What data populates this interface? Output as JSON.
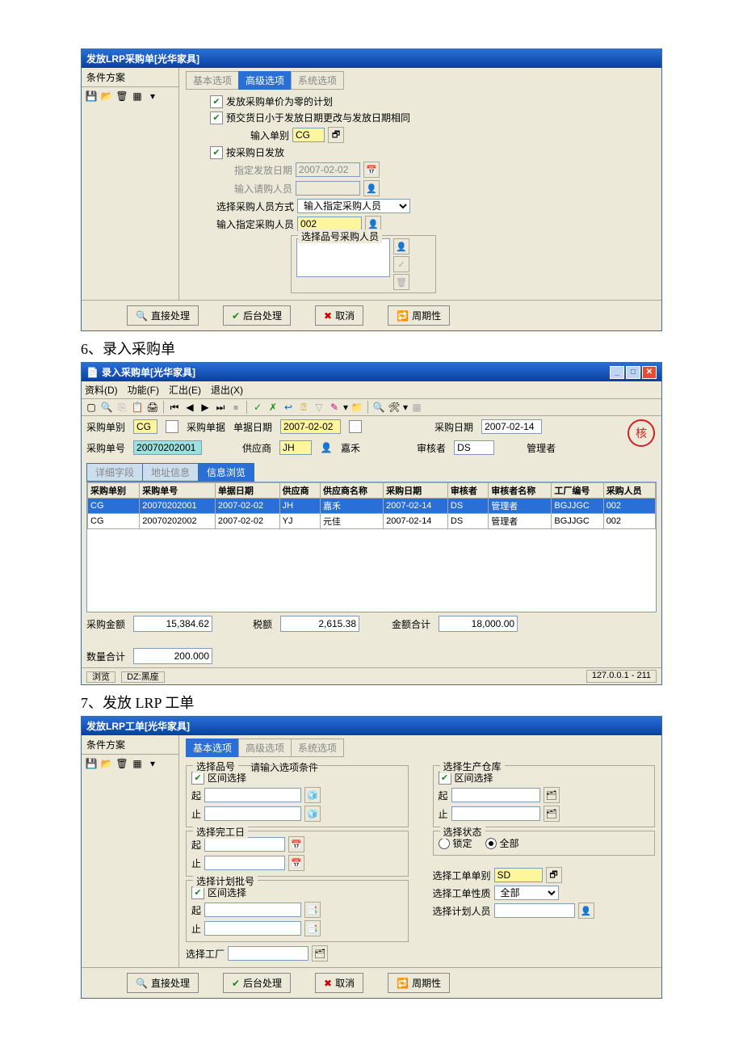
{
  "w1": {
    "title": "发放LRP采购单[光华家具]",
    "leftpanel_header": "条件方案",
    "tabs": [
      "基本选项",
      "高级选项",
      "系统选项"
    ],
    "active_tab": 1,
    "form": {
      "cb1": "发放采购单价为零的计划",
      "cb2": "预交货日小于发放日期更改与发放日期相同",
      "label_input_type": "输入单别",
      "input_type": "CG",
      "cb3": "按采购日发放",
      "label_date": "指定发放日期",
      "date": "2007-02-02",
      "label_req_person": "输入请购人员",
      "label_method": "选择采购人员方式",
      "method": "输入指定采购人员",
      "label_spec_person": "输入指定采购人员",
      "spec_person": "002",
      "group_label": "选择品号采购人员"
    },
    "buttons": {
      "direct": "直接处理",
      "background": "后台处理",
      "cancel": "取消",
      "periodic": "周期性"
    }
  },
  "heading6": "6、录入采购单",
  "w2": {
    "title": "录入采购单[光华家具]",
    "menus": [
      "资料(D)",
      "功能(F)",
      "汇出(E)",
      "退出(X)"
    ],
    "fields": {
      "l_cat": "采购单别",
      "cat": "CG",
      "cb_po": "采购单据",
      "l_docdate": "单据日期",
      "docdate": "2007-02-02",
      "l_podate": "采购日期",
      "podate": "2007-02-14",
      "l_ponum": "采购单号",
      "ponum": "20070202001",
      "l_supplier": "供应商",
      "supplier": "JH",
      "supplier_name": "嘉禾",
      "l_reviewer": "审核者",
      "reviewer": "DS",
      "reviewer_name": "管理者"
    },
    "subtabs": [
      "详细字段",
      "地址信息",
      "信息浏览"
    ],
    "active_subtab": 2,
    "grid": {
      "headers": [
        "采购单别",
        "采购单号",
        "单据日期",
        "供应商",
        "供应商名称",
        "采购日期",
        "审核者",
        "审核者名称",
        "工厂编号",
        "采购人员"
      ],
      "rows": [
        [
          "CG",
          "20070202001",
          "2007-02-02",
          "JH",
          "嘉禾",
          "2007-02-14",
          "DS",
          "管理者",
          "BGJJGC",
          "002"
        ],
        [
          "CG",
          "20070202002",
          "2007-02-02",
          "YJ",
          "元佳",
          "2007-02-14",
          "DS",
          "管理者",
          "BGJJGC",
          "002"
        ]
      ],
      "selected_row": 0
    },
    "totals": {
      "l_amount": "采购金额",
      "amount": "15,384.62",
      "l_tax": "税额",
      "tax": "2,615.38",
      "l_total": "金额合计",
      "total": "18,000.00",
      "l_qty": "数量合计",
      "qty": "200.000"
    },
    "status": {
      "left1": "浏览",
      "left2": "DZ:黑座",
      "right": "127.0.0.1 - 211"
    }
  },
  "heading7": "7、发放 LRP 工单",
  "w3": {
    "title": "发放LRP工单[光华家具]",
    "leftpanel_header": "条件方案",
    "tabs": [
      "基本选项",
      "高级选项",
      "系统选项"
    ],
    "active_tab": 0,
    "hint": "请输入选项条件",
    "left_group1": {
      "legend": "选择品号",
      "cb": "区间选择",
      "l_from": "起",
      "l_to": "止"
    },
    "left_group2": {
      "legend": "选择完工日",
      "l_from": "起",
      "l_to": "止"
    },
    "left_group3": {
      "legend": "选择计划批号",
      "cb": "区间选择",
      "l_from": "起",
      "l_to": "止"
    },
    "l_factory": "选择工厂",
    "right_group1": {
      "legend": "选择生产仓库",
      "cb": "区间选择",
      "l_from": "起",
      "l_to": "止"
    },
    "right_group2": {
      "legend": "选择状态",
      "r1": "锁定",
      "r2": "全部"
    },
    "l_ordercat": "选择工单单别",
    "ordercat": "SD",
    "l_ordernature": "选择工单性质",
    "ordernature": "全部",
    "l_planner": "选择计划人员",
    "buttons": {
      "direct": "直接处理",
      "background": "后台处理",
      "cancel": "取消",
      "periodic": "周期性"
    }
  }
}
